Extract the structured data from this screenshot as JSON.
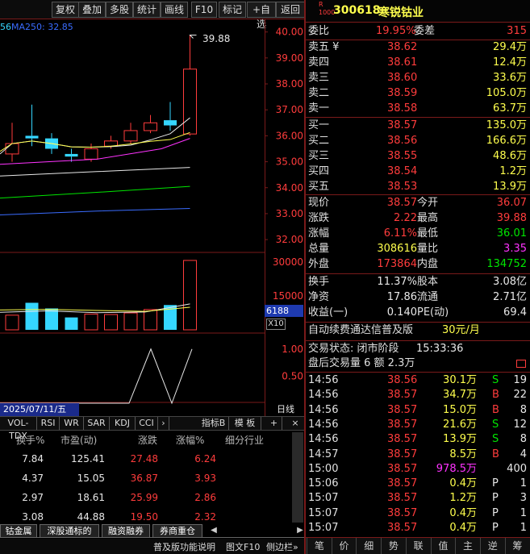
{
  "toolbar": {
    "buttons": [
      "复权",
      "叠加",
      "多股",
      "统计",
      "画线",
      "F10",
      "标记",
      "+自选",
      "返回"
    ]
  },
  "chart": {
    "ma_fragment": "56",
    "ma250_label": "MA250: 32.85",
    "price_axis": [
      "40.00",
      "39.00",
      "38.00",
      "37.00",
      "36.00",
      "35.00",
      "34.00",
      "33.00",
      "32.00"
    ],
    "peak_label": "39.88",
    "vol_axis": [
      "30000",
      "15000"
    ],
    "vol_box": "6188",
    "vol_mult": "X10",
    "ind_axis": [
      "1.00",
      "0.50"
    ],
    "date_label": "2025/07/11/五",
    "period": "日线"
  },
  "indicator_tabs": [
    "VOL-TDX",
    "RSI",
    "WR",
    "SAR",
    "KDJ",
    "CCI"
  ],
  "indicator_tail": {
    "next": "›",
    "label": "指标B",
    "tmpl": "模 板",
    "plus": "+",
    "x": "×"
  },
  "chart_data": {
    "type": "candlestick",
    "price_range": [
      31.6,
      40.3
    ],
    "candles": [
      {
        "o": 35.3,
        "c": 35.7,
        "h": 36.5,
        "l": 35.0,
        "v": 6500
      },
      {
        "o": 36.0,
        "c": 35.9,
        "h": 37.2,
        "l": 35.6,
        "v": 12000
      },
      {
        "o": 35.9,
        "c": 35.5,
        "h": 36.1,
        "l": 35.3,
        "v": 9500
      },
      {
        "o": 35.3,
        "c": 35.2,
        "h": 35.5,
        "l": 35.0,
        "v": 5500
      },
      {
        "o": 35.1,
        "c": 35.5,
        "h": 35.7,
        "l": 35.0,
        "v": 7000
      },
      {
        "o": 35.6,
        "c": 35.8,
        "h": 36.0,
        "l": 35.5,
        "v": 6800
      },
      {
        "o": 35.8,
        "c": 36.2,
        "h": 36.5,
        "l": 35.7,
        "v": 7500
      },
      {
        "o": 36.2,
        "c": 36.5,
        "h": 36.8,
        "l": 36.1,
        "v": 9000
      },
      {
        "o": 36.6,
        "c": 36.4,
        "h": 37.3,
        "l": 36.2,
        "v": 11000
      },
      {
        "o": 36.07,
        "c": 38.57,
        "h": 39.88,
        "l": 36.01,
        "v": 30800
      }
    ],
    "vol_range": [
      0,
      34000
    ],
    "indicator": [
      0,
      0,
      0,
      0,
      0,
      0,
      1.0,
      0,
      1.0
    ],
    "ind_range": [
      0,
      1.25
    ]
  },
  "table": {
    "headers": [
      "换手%",
      "市盈(动)",
      "涨跌",
      "涨幅%",
      "细分行业"
    ],
    "rows": [
      [
        "7.84",
        "125.41",
        "27.48",
        "6.24",
        ""
      ],
      [
        "4.37",
        "15.05",
        "36.87",
        "3.93",
        ""
      ],
      [
        "2.97",
        "18.61",
        "25.99",
        "2.86",
        ""
      ],
      [
        "3.08",
        "44.88",
        "19.50",
        "2.32",
        ""
      ]
    ]
  },
  "bottom_tabs": [
    "钴金属",
    "深股通标的",
    "融资融券",
    "券商重仓"
  ],
  "status_left": "普及版功能说明",
  "status_mid": "图文F10",
  "status_right": "侧边栏»",
  "quote": {
    "badge_top": "R",
    "badge_bottom": "1000",
    "code": "300618",
    "name": "寒锐钴业",
    "weibi_label": "委比",
    "weibi": "19.95%",
    "weicha_label": "委差",
    "weicha": "315",
    "asks": [
      {
        "label": "卖五 ¥",
        "price": "38.62",
        "vol": "29.4万"
      },
      {
        "label": "卖四",
        "price": "38.61",
        "vol": "12.4万"
      },
      {
        "label": "卖三",
        "price": "38.60",
        "vol": "33.6万"
      },
      {
        "label": "卖二",
        "price": "38.59",
        "vol": "105.0万"
      },
      {
        "label": "卖一",
        "price": "38.58",
        "vol": "63.7万"
      }
    ],
    "bids": [
      {
        "label": "买一",
        "price": "38.57",
        "vol": "135.0万"
      },
      {
        "label": "买二",
        "price": "38.56",
        "vol": "166.6万"
      },
      {
        "label": "买三",
        "price": "38.55",
        "vol": "48.6万"
      },
      {
        "label": "买四",
        "price": "38.54",
        "vol": "1.2万"
      },
      {
        "label": "买五",
        "price": "38.53",
        "vol": "13.9万"
      }
    ],
    "stats": [
      {
        "l1": "现价",
        "v1": "38.57",
        "l2": "今开",
        "v2": "36.07"
      },
      {
        "l1": "涨跌",
        "v1": "2.22",
        "l2": "最高",
        "v2": "39.88"
      },
      {
        "l1": "涨幅",
        "v1": "6.11%",
        "l2": "最低",
        "v2": "36.01"
      },
      {
        "l1": "总量",
        "v1": "308616",
        "l2": "量比",
        "v2": "3.35"
      },
      {
        "l1": "外盘",
        "v1": "173864",
        "l2": "内盘",
        "v2": "134752"
      }
    ],
    "fin": [
      {
        "l1": "换手",
        "v1": "11.37%",
        "l2": "股本",
        "v2": "3.08亿"
      },
      {
        "l1": "净资",
        "v1": "17.86",
        "l2": "流通",
        "v2": "2.71亿"
      },
      {
        "l1": "收益(一)",
        "v1": "0.140",
        "l2": "PE(动)",
        "v2": "69.4"
      }
    ],
    "promo": "自动续费通达信普及版",
    "promo_price": "30元/月",
    "trade_status": "交易状态: 闭市阶段",
    "trade_time": "15:33:36",
    "after_hours": "盘后交易量 6 额 2.3万"
  },
  "ticks": [
    {
      "t": "14:56",
      "p": "38.56",
      "v": "30.1万",
      "s": "S",
      "n": "19"
    },
    {
      "t": "14:56",
      "p": "38.57",
      "v": "34.7万",
      "s": "B",
      "n": "22"
    },
    {
      "t": "14:56",
      "p": "38.57",
      "v": "15.0万",
      "s": "B",
      "n": "8"
    },
    {
      "t": "14:56",
      "p": "38.57",
      "v": "21.6万",
      "s": "S",
      "n": "12"
    },
    {
      "t": "14:56",
      "p": "38.57",
      "v": "13.9万",
      "s": "S",
      "n": "8"
    },
    {
      "t": "14:57",
      "p": "38.57",
      "v": "8.5万",
      "s": "B",
      "n": "4"
    },
    {
      "t": "15:00",
      "p": "38.57",
      "v": "978.5万",
      "s": "",
      "n": "400"
    },
    {
      "t": "15:06",
      "p": "38.57",
      "v": "0.4万",
      "s": "P",
      "n": "1"
    },
    {
      "t": "15:07",
      "p": "38.57",
      "v": "1.2万",
      "s": "P",
      "n": "3"
    },
    {
      "t": "15:07",
      "p": "38.57",
      "v": "0.4万",
      "s": "P",
      "n": "1"
    },
    {
      "t": "15:07",
      "p": "38.57",
      "v": "0.4万",
      "s": "P",
      "n": "1"
    }
  ],
  "bottom_tools": [
    "笔",
    "价",
    "细",
    "势",
    "联",
    "值",
    "主",
    "逆",
    "筹"
  ]
}
